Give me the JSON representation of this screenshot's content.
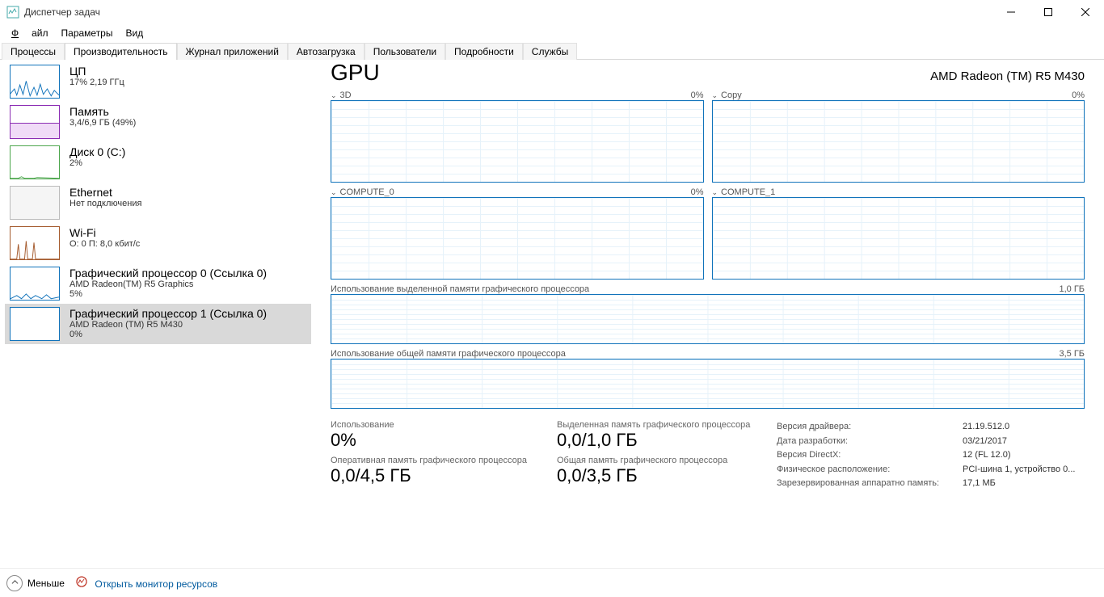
{
  "window": {
    "title": "Диспетчер задач"
  },
  "menu": {
    "file": "Файл",
    "params": "Параметры",
    "view": "Вид"
  },
  "tabs": {
    "processes": "Процессы",
    "performance": "Производительность",
    "apphistory": "Журнал приложений",
    "startup": "Автозагрузка",
    "users": "Пользователи",
    "details": "Подробности",
    "services": "Службы"
  },
  "sidebar": {
    "cpu": {
      "title": "ЦП",
      "subtitle": "17%  2,19 ГГц"
    },
    "memory": {
      "title": "Память",
      "subtitle": "3,4/6,9 ГБ (49%)"
    },
    "disk": {
      "title": "Диск 0 (C:)",
      "subtitle": "2%"
    },
    "eth": {
      "title": "Ethernet",
      "subtitle": "Нет подключения"
    },
    "wifi": {
      "title": "Wi-Fi",
      "subtitle": "О: 0 П: 8,0 кбит/с"
    },
    "gpu0": {
      "title": "Графический процессор 0 (Ссылка 0)",
      "subtitle": "AMD Radeon(TM) R5 Graphics",
      "subtitle2": "5%"
    },
    "gpu1": {
      "title": "Графический процессор 1 (Ссылка 0)",
      "subtitle": "AMD Radeon (TM) R5 M430",
      "subtitle2": "0%"
    }
  },
  "panel": {
    "title": "GPU",
    "subtitle": "AMD Radeon (TM) R5 M430",
    "graphs": {
      "g3d": {
        "label": "3D",
        "value": "0%"
      },
      "copy": {
        "label": "Copy",
        "value": "0%"
      },
      "compute0": {
        "label": "COMPUTE_0",
        "value": "0%"
      },
      "compute1": {
        "label": "COMPUTE_1",
        "value": ""
      },
      "dedmem": {
        "label": "Использование выделенной памяти графического процессора",
        "value": "1,0 ГБ"
      },
      "sharedmem": {
        "label": "Использование общей памяти графического процессора",
        "value": "3,5 ГБ"
      }
    }
  },
  "stats": {
    "utilization_label": "Использование",
    "utilization_value": "0%",
    "gpumem_label": "Оперативная память графического процессора",
    "gpumem_value": "0,0/4,5 ГБ",
    "dedicated_label": "Выделенная память графического процессора",
    "dedicated_value": "0,0/1,0 ГБ",
    "shared_label": "Общая память графического процессора",
    "shared_value": "0,0/3,5 ГБ",
    "driver_ver_k": "Версия драйвера:",
    "driver_ver_v": "21.19.512.0",
    "driver_date_k": "Дата разработки:",
    "driver_date_v": "03/21/2017",
    "directx_k": "Версия DirectX:",
    "directx_v": "12 (FL 12.0)",
    "phys_k": "Физическое расположение:",
    "phys_v": "PCI-шина 1, устройство 0...",
    "hwres_k": "Зарезервированная аппаратно память:",
    "hwres_v": "17,1 МБ"
  },
  "bottom": {
    "less": "Меньше",
    "openmon": "Открыть монитор ресурсов"
  }
}
